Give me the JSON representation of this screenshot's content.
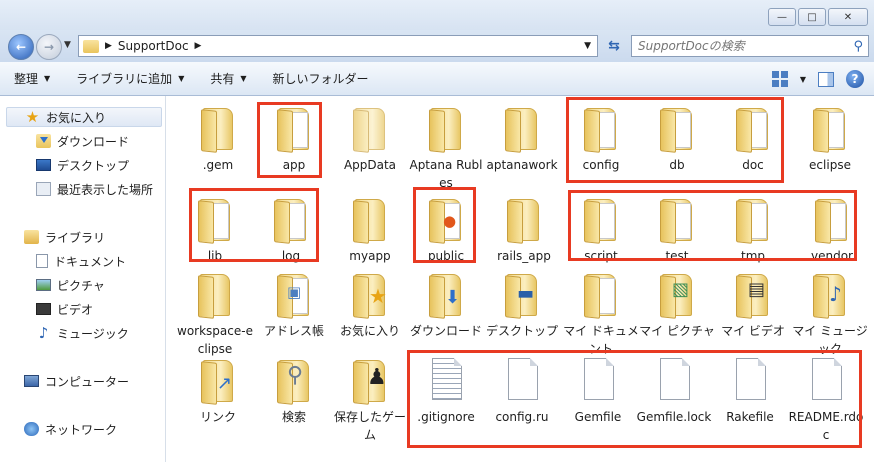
{
  "window": {
    "minimize": "—",
    "maximize": "□",
    "close": "✕"
  },
  "address": {
    "crumb": "SupportDoc",
    "search_placeholder": "SupportDocの検索"
  },
  "command_bar": [
    "整理",
    "ライブラリに追加",
    "共有",
    "新しいフォルダー"
  ],
  "nav_pane": {
    "favorites": {
      "label": "お気に入り",
      "items": [
        "ダウンロード",
        "デスクトップ",
        "最近表示した場所"
      ]
    },
    "libraries": {
      "label": "ライブラリ",
      "items": [
        "ドキュメント",
        "ピクチャ",
        "ビデオ",
        "ミュージック"
      ]
    },
    "computer": "コンピューター",
    "network": "ネットワーク"
  },
  "items": [
    {
      "label": ".gem",
      "kind": "folder"
    },
    {
      "label": "app",
      "kind": "folder"
    },
    {
      "label": "AppData",
      "kind": "folder"
    },
    {
      "label": "Aptana Rubles",
      "kind": "folder"
    },
    {
      "label": "aptanawork",
      "kind": "folder"
    },
    {
      "label": "config",
      "kind": "folder"
    },
    {
      "label": "db",
      "kind": "folder"
    },
    {
      "label": "doc",
      "kind": "folder"
    },
    {
      "label": "eclipse",
      "kind": "folder"
    },
    {
      "label": "lib",
      "kind": "folder"
    },
    {
      "label": "log",
      "kind": "folder"
    },
    {
      "label": "myapp",
      "kind": "folder"
    },
    {
      "label": "public",
      "kind": "folder"
    },
    {
      "label": "rails_app",
      "kind": "folder"
    },
    {
      "label": "script",
      "kind": "folder"
    },
    {
      "label": "test",
      "kind": "folder"
    },
    {
      "label": "tmp",
      "kind": "folder"
    },
    {
      "label": "vendor",
      "kind": "folder"
    },
    {
      "label": "workspace-eclipse",
      "kind": "folder"
    },
    {
      "label": "アドレス帳",
      "kind": "folder"
    },
    {
      "label": "お気に入り",
      "kind": "folder"
    },
    {
      "label": "ダウンロード",
      "kind": "folder"
    },
    {
      "label": "デスクトップ",
      "kind": "folder"
    },
    {
      "label": "マイ ドキュメント",
      "kind": "folder"
    },
    {
      "label": "マイ ピクチャ",
      "kind": "folder"
    },
    {
      "label": "マイ ビデオ",
      "kind": "folder"
    },
    {
      "label": "マイ ミュージック",
      "kind": "folder"
    },
    {
      "label": "リンク",
      "kind": "folder"
    },
    {
      "label": "検索",
      "kind": "folder"
    },
    {
      "label": "保存したゲーム",
      "kind": "folder"
    },
    {
      "label": ".gitignore",
      "kind": "file"
    },
    {
      "label": "config.ru",
      "kind": "file"
    },
    {
      "label": "Gemfile",
      "kind": "file"
    },
    {
      "label": "Gemfile.lock",
      "kind": "file"
    },
    {
      "label": "Rakefile",
      "kind": "file"
    },
    {
      "label": "README.rdoc",
      "kind": "file"
    }
  ]
}
